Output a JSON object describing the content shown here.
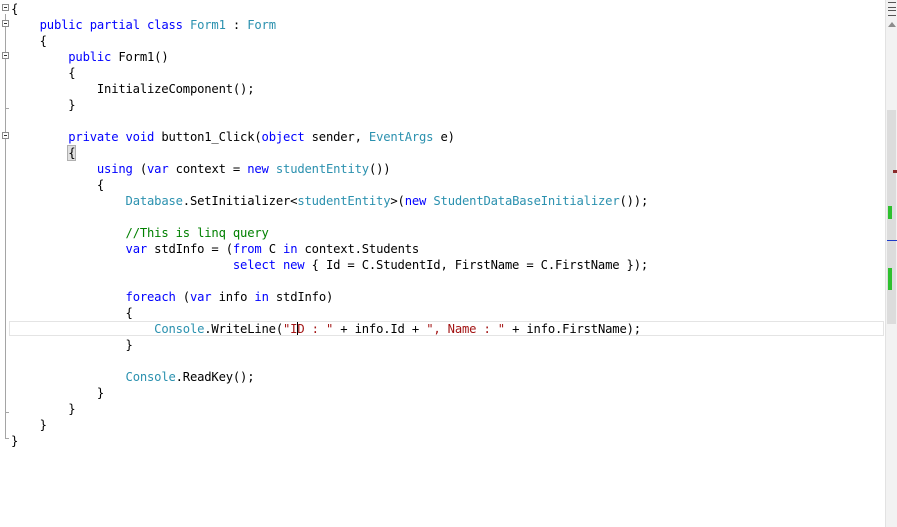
{
  "code": {
    "lines": [
      [
        {
          "t": "{",
          "c": ""
        }
      ],
      [
        {
          "t": "    ",
          "c": ""
        },
        {
          "t": "public partial class ",
          "c": "kw"
        },
        {
          "t": "Form1",
          "c": "ty"
        },
        {
          "t": " : ",
          "c": ""
        },
        {
          "t": "Form",
          "c": "ty"
        }
      ],
      [
        {
          "t": "    {",
          "c": ""
        }
      ],
      [
        {
          "t": "        ",
          "c": ""
        },
        {
          "t": "public",
          "c": "kw"
        },
        {
          "t": " Form1()",
          "c": ""
        }
      ],
      [
        {
          "t": "        {",
          "c": ""
        }
      ],
      [
        {
          "t": "            InitializeComponent();",
          "c": ""
        }
      ],
      [
        {
          "t": "        }",
          "c": ""
        }
      ],
      [],
      [
        {
          "t": "        ",
          "c": ""
        },
        {
          "t": "private void",
          "c": "kw"
        },
        {
          "t": " button1_Click(",
          "c": ""
        },
        {
          "t": "object",
          "c": "kw"
        },
        {
          "t": " sender, ",
          "c": ""
        },
        {
          "t": "EventArgs",
          "c": "ty"
        },
        {
          "t": " e)",
          "c": ""
        }
      ],
      [
        {
          "t": "        ",
          "c": ""
        },
        {
          "t": "{",
          "c": "brace"
        }
      ],
      [
        {
          "t": "            ",
          "c": ""
        },
        {
          "t": "using",
          "c": "kw"
        },
        {
          "t": " (",
          "c": ""
        },
        {
          "t": "var",
          "c": "kw"
        },
        {
          "t": " context = ",
          "c": ""
        },
        {
          "t": "new",
          "c": "kw"
        },
        {
          "t": " ",
          "c": ""
        },
        {
          "t": "studentEntity",
          "c": "ty"
        },
        {
          "t": "())",
          "c": ""
        }
      ],
      [
        {
          "t": "            {",
          "c": ""
        }
      ],
      [
        {
          "t": "                ",
          "c": ""
        },
        {
          "t": "Database",
          "c": "ty"
        },
        {
          "t": ".SetInitializer<",
          "c": ""
        },
        {
          "t": "studentEntity",
          "c": "ty"
        },
        {
          "t": ">(",
          "c": ""
        },
        {
          "t": "new",
          "c": "kw"
        },
        {
          "t": " ",
          "c": ""
        },
        {
          "t": "StudentDataBaseInitializer",
          "c": "ty"
        },
        {
          "t": "());",
          "c": ""
        }
      ],
      [],
      [
        {
          "t": "                ",
          "c": ""
        },
        {
          "t": "//This is linq query",
          "c": "cm"
        }
      ],
      [
        {
          "t": "                ",
          "c": ""
        },
        {
          "t": "var",
          "c": "kw"
        },
        {
          "t": " stdInfo = (",
          "c": ""
        },
        {
          "t": "from",
          "c": "kw"
        },
        {
          "t": " C ",
          "c": ""
        },
        {
          "t": "in",
          "c": "kw"
        },
        {
          "t": " context.Students",
          "c": ""
        }
      ],
      [
        {
          "t": "                               ",
          "c": ""
        },
        {
          "t": "select new",
          "c": "kw"
        },
        {
          "t": " { Id = C.StudentId, FirstName = C.FirstName });",
          "c": ""
        }
      ],
      [],
      [
        {
          "t": "                ",
          "c": ""
        },
        {
          "t": "foreach",
          "c": "kw"
        },
        {
          "t": " (",
          "c": ""
        },
        {
          "t": "var",
          "c": "kw"
        },
        {
          "t": " info ",
          "c": ""
        },
        {
          "t": "in",
          "c": "kw"
        },
        {
          "t": " stdInfo)",
          "c": ""
        }
      ],
      [
        {
          "t": "                {",
          "c": ""
        }
      ],
      [
        {
          "t": "                    ",
          "c": ""
        },
        {
          "t": "Console",
          "c": "ty"
        },
        {
          "t": ".WriteLine(",
          "c": ""
        },
        {
          "t": "\"I",
          "c": "st"
        },
        {
          "t": "",
          "c": "caret"
        },
        {
          "t": "D : \"",
          "c": "st"
        },
        {
          "t": " + info.Id + ",
          "c": ""
        },
        {
          "t": "\", Name : \"",
          "c": "st"
        },
        {
          "t": " + info.FirstName);",
          "c": ""
        }
      ],
      [
        {
          "t": "                }",
          "c": ""
        }
      ],
      [],
      [
        {
          "t": "                ",
          "c": ""
        },
        {
          "t": "Console",
          "c": "ty"
        },
        {
          "t": ".ReadKey();",
          "c": ""
        }
      ],
      [
        {
          "t": "            }",
          "c": ""
        }
      ],
      [
        {
          "t": "        }",
          "c": ""
        }
      ],
      [
        {
          "t": "    }",
          "c": ""
        }
      ],
      [
        {
          "t": "}",
          "c": ""
        }
      ]
    ]
  },
  "scrollbar": {
    "markers": [
      {
        "name": "error-marker",
        "color": "#8b2b2b"
      },
      {
        "name": "change-marker-1",
        "color": "#2ec02e"
      },
      {
        "name": "caret-marker",
        "color": "#1e3cc8"
      },
      {
        "name": "change-marker-2",
        "color": "#2ec02e"
      }
    ]
  }
}
